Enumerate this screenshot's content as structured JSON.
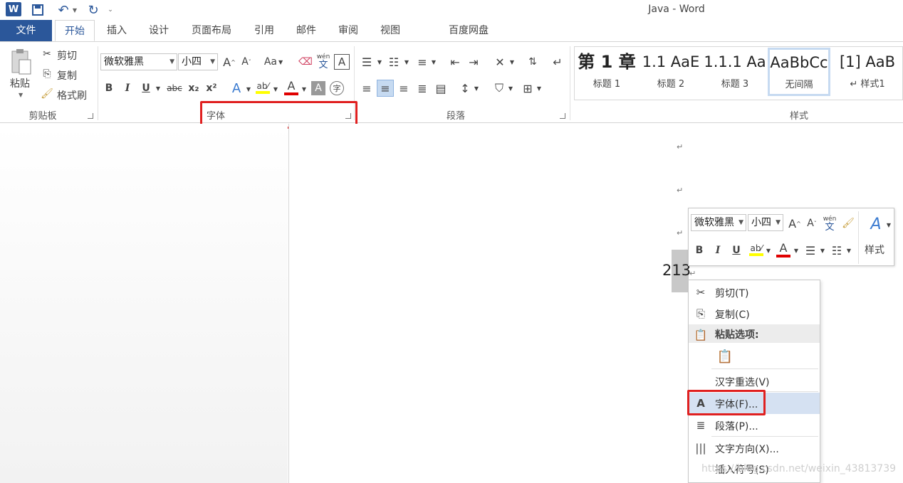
{
  "title_bar": {
    "app_logo": "W",
    "window_title": "Java - Word",
    "quick_access": [
      "save-icon",
      "undo-icon",
      "redo-icon",
      "customize-icon"
    ]
  },
  "tabs": [
    "文件",
    "开始",
    "插入",
    "设计",
    "页面布局",
    "引用",
    "邮件",
    "审阅",
    "视图",
    "百度网盘"
  ],
  "ribbon": {
    "clipboard": {
      "paste": "粘贴",
      "cut": "剪切",
      "copy": "复制",
      "format_painter": "格式刷",
      "label": "剪贴板"
    },
    "font": {
      "font_name": "微软雅黑",
      "font_size": "小四",
      "change_case": "Aa",
      "phonetic_top": "wén",
      "phonetic_bottom": "文",
      "bold": "B",
      "italic": "I",
      "underline": "U",
      "strike": "abc",
      "subscript": "x₂",
      "superscript": "x²",
      "label": "字体"
    },
    "paragraph": {
      "label": "段落"
    },
    "styles": {
      "label": "样式",
      "items": [
        {
          "sample": "第 1 章",
          "name": "标题 1"
        },
        {
          "sample": "1.1  AaE",
          "name": "标题 2"
        },
        {
          "sample": "1.1.1  Aa",
          "name": "标题 3"
        },
        {
          "sample": "AaBbCc",
          "name": "无间隔"
        },
        {
          "sample": "[1]  AaB",
          "name": "↵ 样式1"
        }
      ]
    }
  },
  "document": {
    "para_mark": "↵",
    "selected_text": "213"
  },
  "mini_toolbar": {
    "font_name": "微软雅黑",
    "font_size": "小四",
    "styles_label": "样式",
    "bold": "B",
    "italic": "I",
    "underline": "U"
  },
  "context_menu": {
    "items": [
      {
        "label": "剪切(T)",
        "icon": "scissors-icon"
      },
      {
        "label": "复制(C)",
        "icon": "copy-icon"
      },
      {
        "label": "粘贴选项:",
        "icon": "paste-icon"
      },
      {
        "label": "汉字重选(V)",
        "icon": ""
      },
      {
        "label": "字体(F)...",
        "icon": "font-icon"
      },
      {
        "label": "段落(P)...",
        "icon": "paragraph-icon"
      },
      {
        "label": "文字方向(X)...",
        "icon": "text-direction-icon"
      },
      {
        "label": "插入符号(S)",
        "icon": ""
      }
    ]
  },
  "watermark": "https://blog.csdn.net/weixin_43813739",
  "colors": {
    "accent": "#2b579a",
    "highlight_box": "#e02020",
    "menu_hover": "#d5e1f2"
  }
}
